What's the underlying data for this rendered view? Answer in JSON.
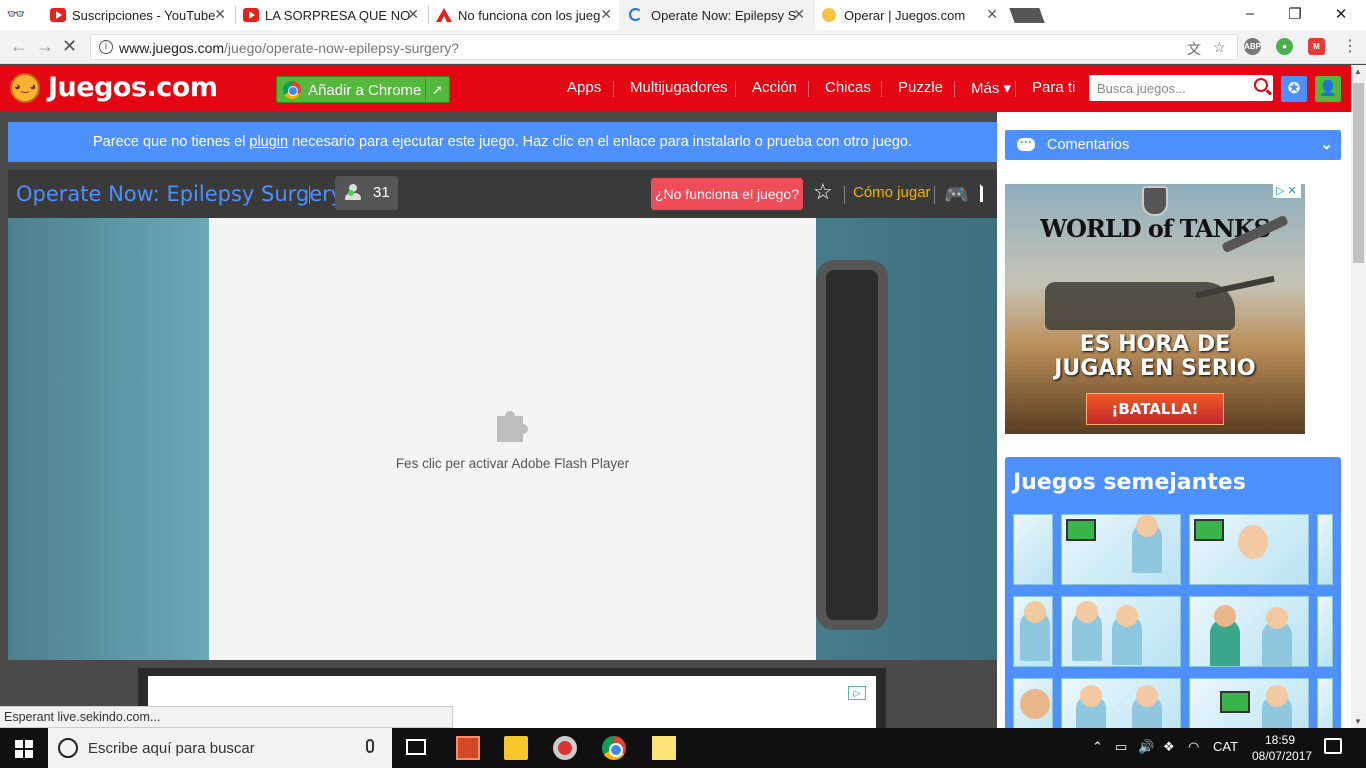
{
  "browser": {
    "tabs": [
      {
        "title": "Suscripciones - YouTube",
        "icon": "youtube-icon",
        "active": false
      },
      {
        "title": "LA SORPRESA QUE NOS",
        "icon": "youtube-icon",
        "active": false
      },
      {
        "title": "No funciona con los jueg",
        "icon": "adobe-icon",
        "active": false
      },
      {
        "title": "Operate Now: Epilepsy S",
        "icon": "loading-spinner-icon",
        "active": true
      },
      {
        "title": "Operar | Juegos.com",
        "icon": "juegos-favicon",
        "active": false
      }
    ],
    "url_host": "www.juegos.com",
    "url_path": "/juego/operate-now-epilepsy-surgery?",
    "extensions": [
      "ABP"
    ]
  },
  "site": {
    "logo_text": "Juegos.com",
    "add_chrome_label": "Añadir a Chrome",
    "nav": [
      "Apps",
      "Multijugadores",
      "Acción",
      "Chicas",
      "Puzzle",
      "Más ▾",
      "Para ti"
    ],
    "search_placeholder": "Busca juegos..."
  },
  "plugin_notice": {
    "before": "Parece que no tienes el ",
    "link": "plugin",
    "after": " necesario para ejecutar este juego. Haz clic en el enlace para instalarlo o prueba con otro juego."
  },
  "game": {
    "title": "Operate Now: Epilepsy Surgery",
    "players": "31",
    "broken_label": "¿No funciona el juego?",
    "howto_label": "Cómo jugar",
    "flash_message": "Fes clic per activar Adobe Flash Player"
  },
  "status_text": "Esperant live.sekindo.com...",
  "sidebar": {
    "comments_label": "Comentarios",
    "ad": {
      "brand": "WORLD of TANKS",
      "line1": "ES HORA DE",
      "line2": "JUGAR EN SERIO",
      "cta": "¡BATALLA!"
    },
    "similar_title": "Juegos semejantes"
  },
  "taskbar": {
    "search_placeholder": "Escribe aquí para buscar",
    "language": "CAT",
    "time": "18:59",
    "date": "08/07/2017"
  },
  "colors": {
    "brand_red": "#e40613",
    "accent_blue": "#4d90fe",
    "button_green": "#54b83c",
    "broken_red": "#ee4c58",
    "howto_yellow": "#f4b400"
  }
}
